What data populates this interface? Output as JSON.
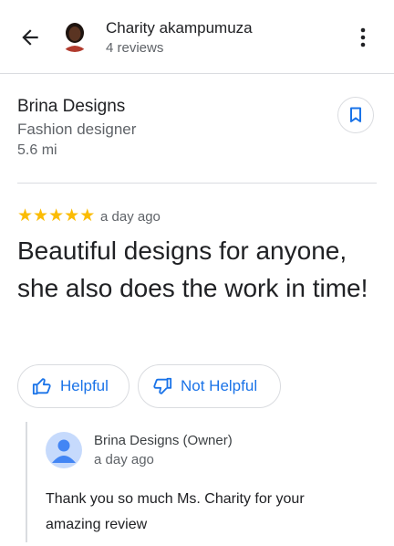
{
  "header": {
    "user_name": "Charity akampumuza",
    "review_count": "4 reviews",
    "back_icon": "arrow-back-icon",
    "more_icon": "more-vert-icon"
  },
  "place": {
    "name": "Brina Designs",
    "category": "Fashion designer",
    "distance": "5.6 mi",
    "bookmark_icon": "bookmark-icon"
  },
  "review": {
    "rating": 5,
    "stars": [
      "★",
      "★",
      "★",
      "★",
      "★"
    ],
    "time": "a day ago",
    "text": "Beautiful designs for anyone, she also does the work in time!"
  },
  "actions": {
    "helpful_label": "Helpful",
    "not_helpful_label": "Not Helpful"
  },
  "owner_response": {
    "name": "Brina Designs (Owner)",
    "time": "a day ago",
    "text": "Thank you so much Ms. Charity for your amazing review"
  },
  "colors": {
    "accent": "#1a73e8",
    "star": "#fbbc04",
    "divider": "#dadce0"
  }
}
